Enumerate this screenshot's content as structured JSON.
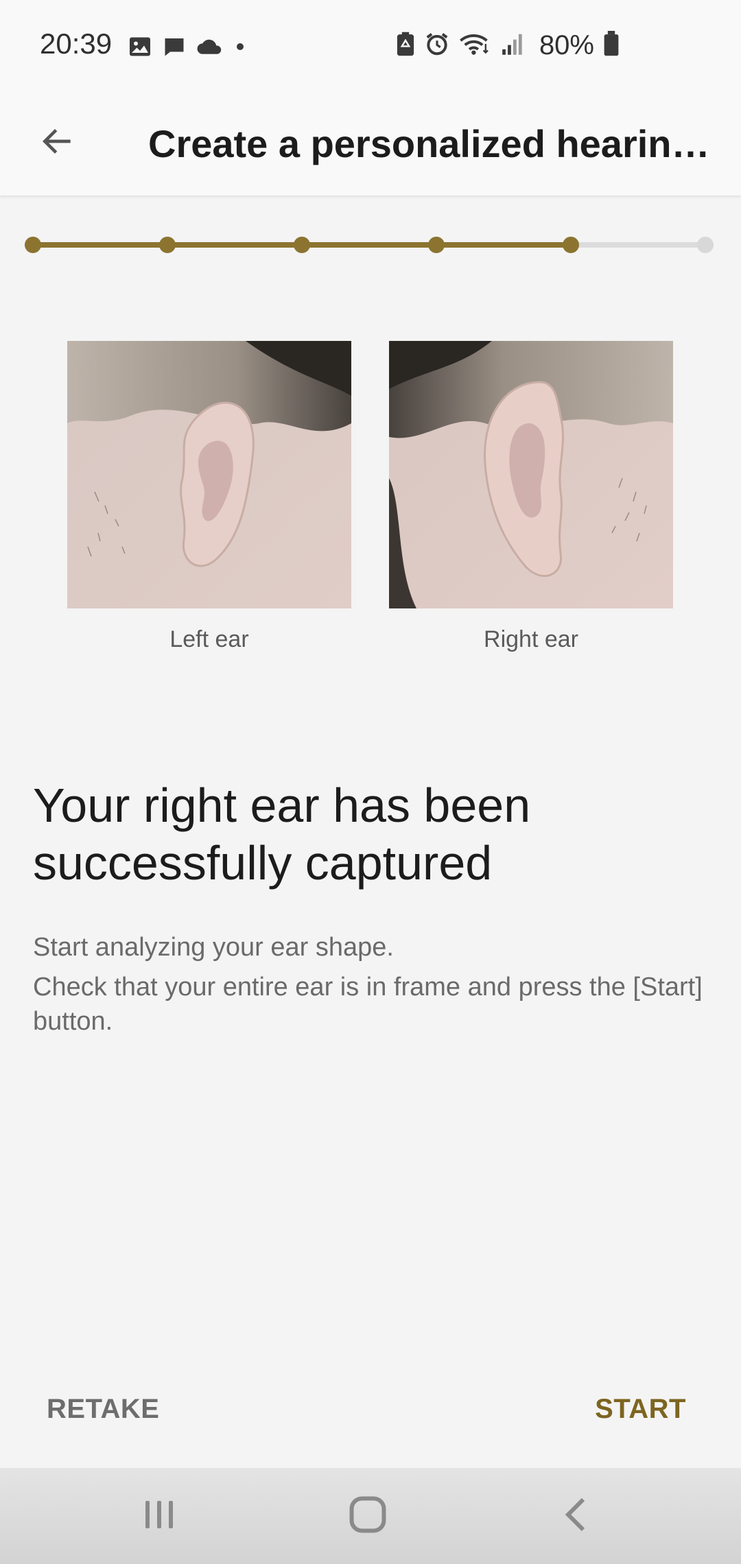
{
  "status_bar": {
    "time": "20:39",
    "battery": "80%",
    "left_icons": [
      "gallery-icon",
      "message-icon",
      "cloud-icon",
      "dot-icon"
    ],
    "right_icons": [
      "battery-saver-icon",
      "alarm-icon",
      "wifi-icon",
      "signal-icon",
      "battery-icon"
    ]
  },
  "app_bar": {
    "title": "Create a personalized hearing…"
  },
  "progress": {
    "total_steps": 6,
    "completed_steps": 5,
    "active_color": "#8c7430",
    "inactive_color": "#d8d8d8"
  },
  "photos": [
    {
      "label": "Left ear"
    },
    {
      "label": "Right ear"
    }
  ],
  "content": {
    "headline": "Your right ear has been successfully captured",
    "body_line1": "Start analyzing your ear shape.",
    "body_line2": "Check that your entire ear is in frame and press the [Start] button."
  },
  "actions": {
    "retake": "RETAKE",
    "start": "START"
  },
  "nav_bar": {
    "icons": [
      "recent-apps-icon",
      "home-icon",
      "back-nav-icon"
    ]
  },
  "colors": {
    "accent": "#8c7430",
    "start_button": "#7d6520",
    "background": "#f4f4f4"
  }
}
